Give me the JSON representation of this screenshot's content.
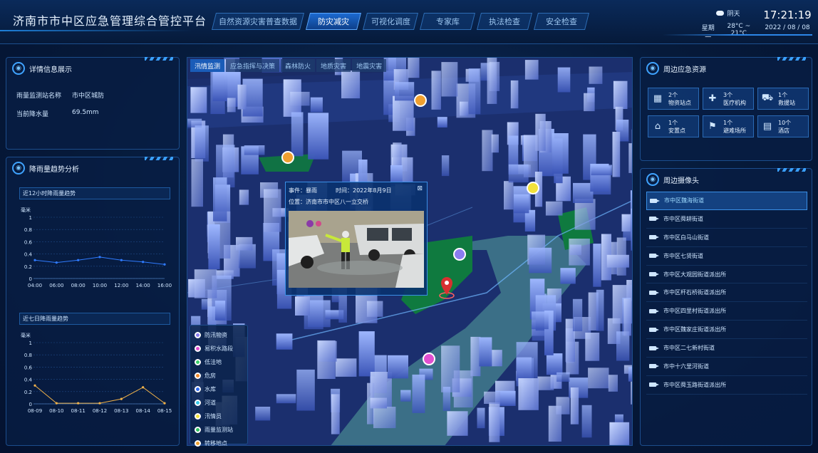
{
  "header": {
    "title": "济南市市中区应急管理综合管控平台",
    "nav": [
      "自然资源灾害普查数据",
      "防灾减灾",
      "可视化调度",
      "专家库",
      "执法检查",
      "安全检查"
    ],
    "active_nav": 1,
    "weather": {
      "condition": "阴天",
      "weekday": "星期一",
      "temp": "28°C ~ 21°C"
    },
    "time": "17:21:19",
    "date": "2022 / 08 / 08"
  },
  "detail_panel": {
    "title": "详情信息展示",
    "station_label": "雨量监测站名称",
    "station_value": "市中区城防",
    "rain_label": "当前降水量",
    "rain_value": "69.5mm"
  },
  "trend_panel": {
    "title": "降雨量趋势分析",
    "chart1_title": "近12小时降雨量趋势",
    "chart2_title": "近七日降雨量趋势"
  },
  "chart_data": [
    {
      "type": "line",
      "title": "近12小时降雨量趋势",
      "ylabel": "毫米",
      "categories": [
        "04:00",
        "06:00",
        "08:00",
        "10:00",
        "12:00",
        "14:00",
        "16:00"
      ],
      "values": [
        0.3,
        0.26,
        0.3,
        0.35,
        0.3,
        0.27,
        0.23
      ],
      "ylim": [
        0,
        1
      ],
      "yticks": [
        "0",
        "0.2",
        "0.4",
        "0.6",
        "0.8",
        "1"
      ],
      "color": "#2f7bff"
    },
    {
      "type": "line",
      "title": "近七日降雨量趋势",
      "ylabel": "毫米",
      "categories": [
        "08-09",
        "08-10",
        "08-11",
        "08-12",
        "08-13",
        "08-14",
        "08-15"
      ],
      "values": [
        0.3,
        0.01,
        0.01,
        0.01,
        0.08,
        0.27,
        0.01
      ],
      "ylim": [
        0,
        1
      ],
      "yticks": [
        "0",
        "0.2",
        "0.4",
        "0.6",
        "0.8",
        "1"
      ],
      "color": "#f0b24a"
    }
  ],
  "map": {
    "tabs": [
      "汛情监测",
      "应急指挥与决策",
      "森林防火",
      "地质灾害",
      "地震灾害"
    ],
    "active_tab": 0,
    "popup": {
      "event_label": "事件：暴雨",
      "time_label": "时间：2022年8月9日",
      "location_label": "位置：济南市市中区八一立交桥",
      "close": "⊠"
    },
    "legend": [
      {
        "label": "防汛物资",
        "color": "#8a7cf0"
      },
      {
        "label": "易积水路段",
        "color": "#e04fd0"
      },
      {
        "label": "低洼地",
        "color": "#3ad06a"
      },
      {
        "label": "危房",
        "color": "#f08a2a"
      },
      {
        "label": "水库",
        "color": "#2f6cf0"
      },
      {
        "label": "河道",
        "color": "#38c8e8"
      },
      {
        "label": "汛情员",
        "color": "#f2e23a"
      },
      {
        "label": "雨量监测站",
        "color": "#2fc060"
      },
      {
        "label": "转移地点",
        "color": "#f0a030"
      }
    ]
  },
  "resources_panel": {
    "title": "周边应急资源",
    "items": [
      {
        "count": "2个",
        "label": "物资站点",
        "icon": "warehouse-icon",
        "glyph": "▦"
      },
      {
        "count": "3个",
        "label": "医疗机构",
        "icon": "hospital-icon",
        "glyph": "✚"
      },
      {
        "count": "1个",
        "label": "救援站",
        "icon": "rescue-truck-icon",
        "glyph": "⛟"
      },
      {
        "count": "1个",
        "label": "安置点",
        "icon": "shelter-icon",
        "glyph": "⌂"
      },
      {
        "count": "1个",
        "label": "避难场所",
        "icon": "refuge-icon",
        "glyph": "⚑"
      },
      {
        "count": "10个",
        "label": "酒店",
        "icon": "hotel-icon",
        "glyph": "▤"
      }
    ]
  },
  "cameras_panel": {
    "title": "周边摄像头",
    "items": [
      "市中区魏海街道",
      "市中区舜耕街道",
      "市中区白马山街道",
      "市中区七贤街道",
      "市中区大观园街道派出所",
      "市中区杆石桥街道派出所",
      "市中区四里村街道派出所",
      "市中区魏家庄街道派出所",
      "市中区二七新村街道",
      "市中十六里河街道",
      "市中区舜玉路街道派出所"
    ],
    "active": 0
  }
}
